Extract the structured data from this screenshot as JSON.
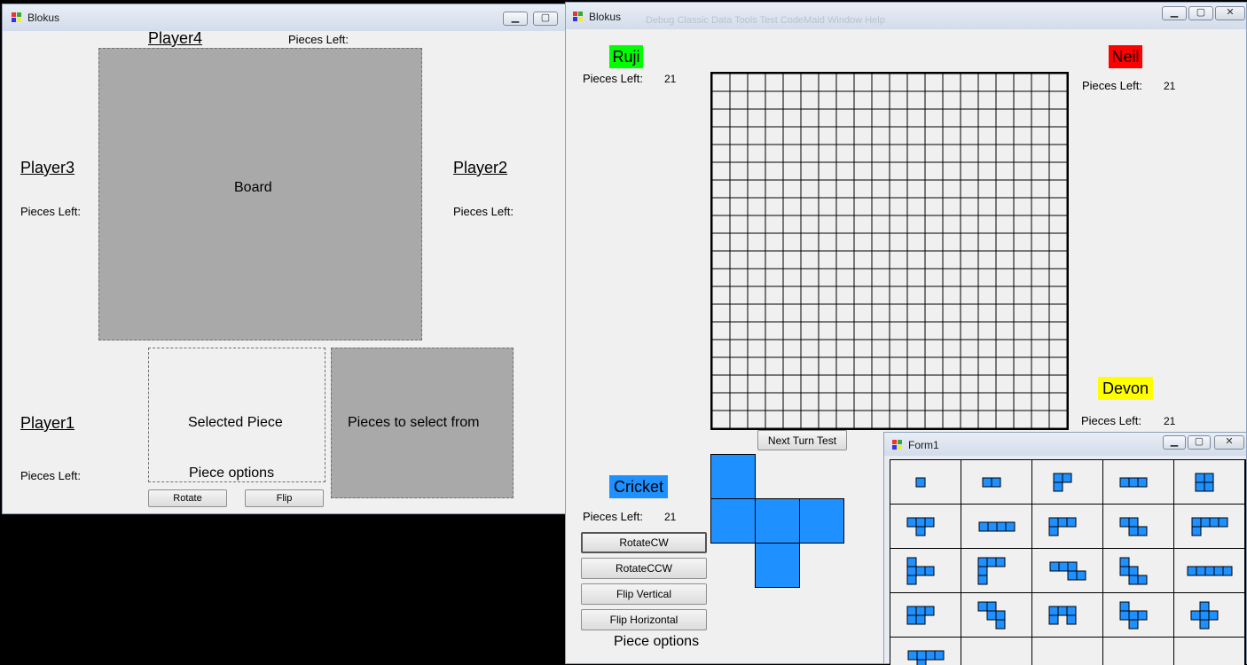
{
  "designer": {
    "title": "Blokus",
    "player4": "Player4",
    "pieces_left_top": "Pieces Left:",
    "player3": "Player3",
    "player3_pieces": "Pieces Left:",
    "player2": "Player2",
    "player2_pieces": "Pieces Left:",
    "board_label": "Board",
    "player1": "Player1",
    "player1_pieces": "Pieces Left:",
    "selected_piece": "Selected Piece",
    "piece_options": "Piece options",
    "pieces_select": "Pieces to select from",
    "rotate_btn": "Rotate",
    "flip_btn": "Flip"
  },
  "game": {
    "title": "Blokus",
    "menu_text": "Debug  Classic  Data  Tools  Test  CodeMaid  Window  Help",
    "players": {
      "ruji": {
        "name": "Ruji",
        "pieces_label": "Pieces Left:",
        "pieces": "21",
        "color": "#00ff00"
      },
      "neil": {
        "name": "Neil",
        "pieces_label": "Pieces Left:",
        "pieces": "21",
        "color": "#ff0000"
      },
      "devon": {
        "name": "Devon",
        "pieces_label": "Pieces Left:",
        "pieces": "21",
        "color": "#ffff00"
      },
      "cricket": {
        "name": "Cricket",
        "pieces_label": "Pieces Left:",
        "pieces": "21",
        "color": "#1e90ff"
      }
    },
    "board_size": 20,
    "next_turn": "Next Turn Test",
    "rotate_cw": "RotateCW",
    "rotate_ccw": "RotateCCW",
    "flip_vertical": "Flip Vertical",
    "flip_horizontal": "Flip Horizontal",
    "piece_options": "Piece options",
    "piece_color": "#1e90ff"
  },
  "form1": {
    "title": "Form1"
  }
}
